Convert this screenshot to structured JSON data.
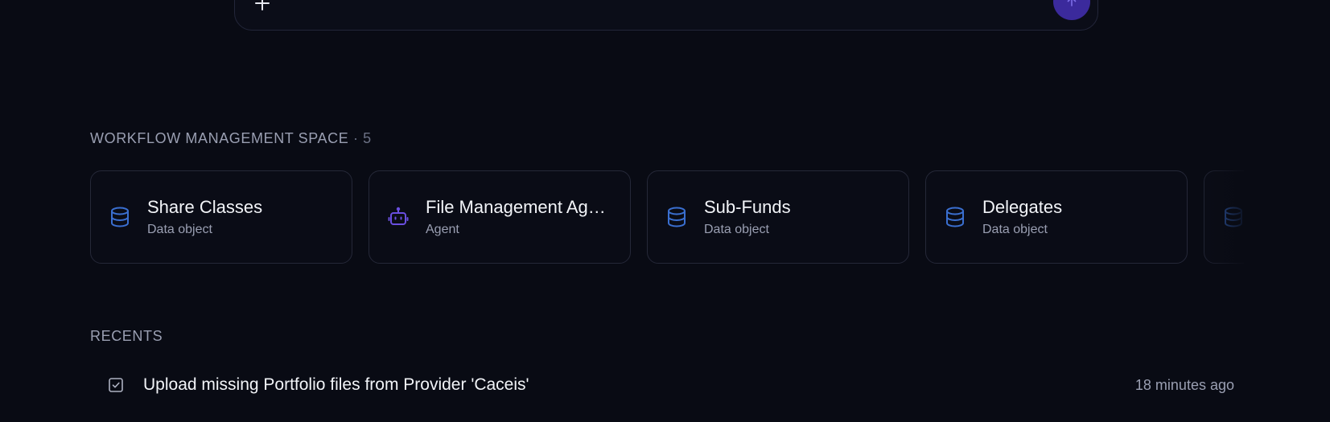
{
  "composer": {
    "add_icon": "plus-icon",
    "send_icon": "arrow-up-icon"
  },
  "space": {
    "title": "WORKFLOW MANAGEMENT SPACE",
    "separator": " · ",
    "count": "5",
    "items": [
      {
        "name": "Share Classes",
        "type": "Data object",
        "icon": "database-icon"
      },
      {
        "name": "File Management Agent",
        "type": "Agent",
        "icon": "robot-icon"
      },
      {
        "name": "Sub-Funds",
        "type": "Data object",
        "icon": "database-icon"
      },
      {
        "name": "Delegates",
        "type": "Data object",
        "icon": "database-icon"
      },
      {
        "name": "",
        "type": "",
        "icon": "database-icon"
      }
    ]
  },
  "recents": {
    "title": "RECENTS",
    "items": [
      {
        "title": "Upload missing Portfolio files from Provider 'Caceis'",
        "time": "18 minutes ago",
        "icon": "checkbox-icon"
      }
    ]
  },
  "colors": {
    "background": "#090b14",
    "accent": "#3b2a9c",
    "data_icon": "#3a6fd0",
    "agent_icon": "#6a4fe0"
  }
}
